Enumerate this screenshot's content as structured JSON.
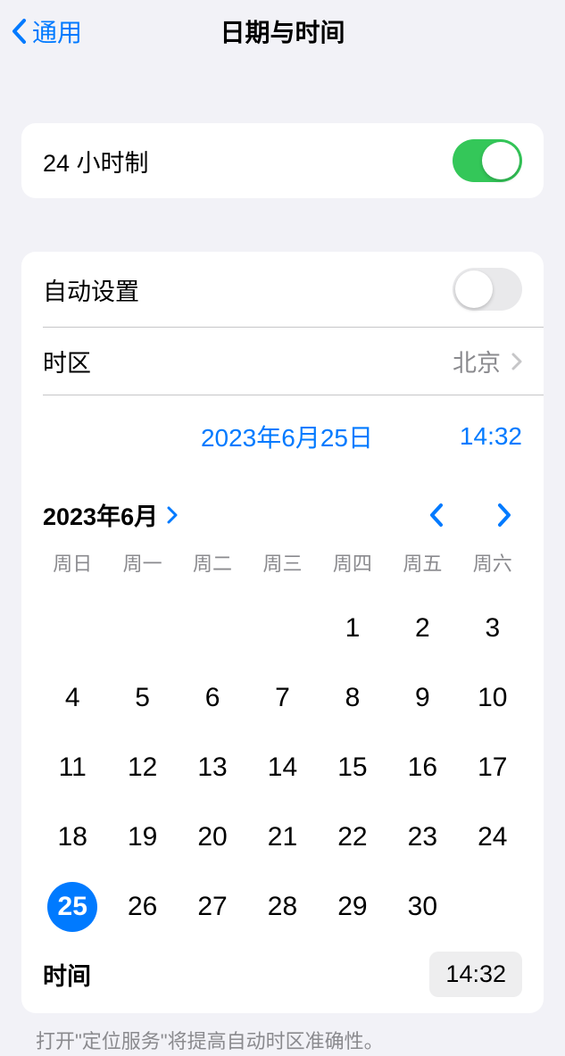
{
  "nav": {
    "back_label": "通用",
    "title": "日期与时间"
  },
  "settings": {
    "clock_24h_label": "24 小时制",
    "clock_24h_on": true,
    "auto_set_label": "自动设置",
    "auto_set_on": false,
    "timezone_label": "时区",
    "timezone_value": "北京"
  },
  "datetime_display": {
    "date": "2023年6月25日",
    "time": "14:32"
  },
  "calendar": {
    "month_label": "2023年6月",
    "weekdays": [
      "周日",
      "周一",
      "周二",
      "周三",
      "周四",
      "周五",
      "周六"
    ],
    "leading_blanks": 4,
    "days_in_month": 30,
    "selected_day": 25
  },
  "time_picker": {
    "label": "时间",
    "value": "14:32"
  },
  "footer": "打开\"定位服务\"将提高自动时区准确性。",
  "colors": {
    "accent": "#007aff",
    "switch_on": "#34c759"
  }
}
